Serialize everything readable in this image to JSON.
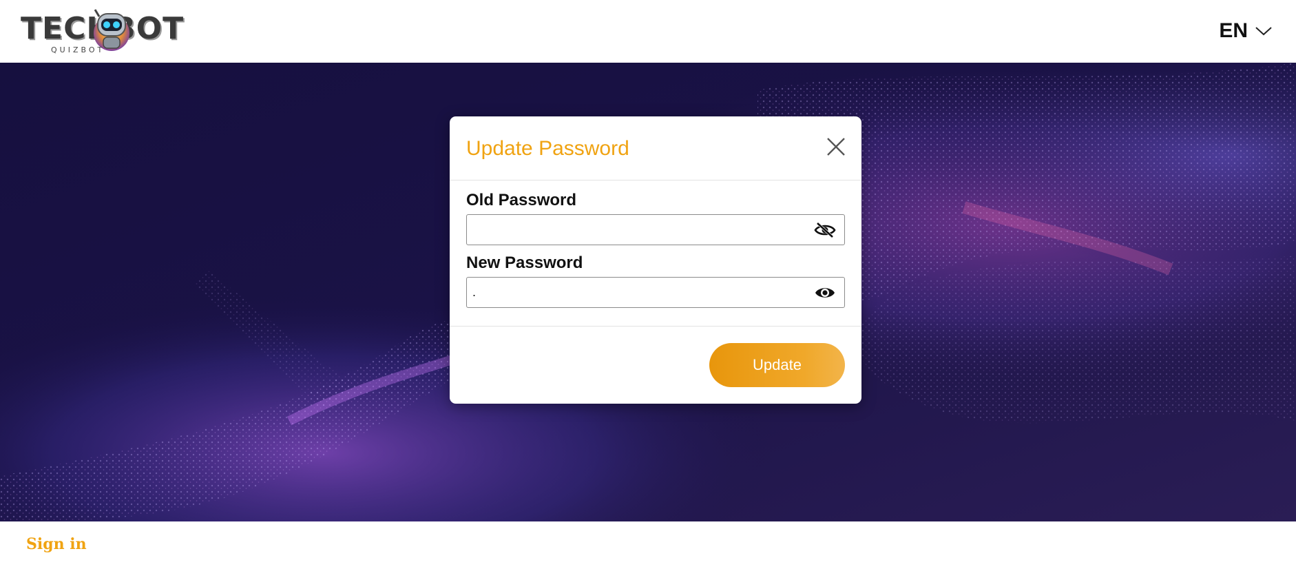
{
  "header": {
    "logo_text": "TECHBOT",
    "logo_subtext": "QUIZBOT",
    "language": {
      "selected": "EN",
      "icon": "chevron-down-icon"
    }
  },
  "modal": {
    "title": "Update Password",
    "close_icon": "close-icon",
    "fields": {
      "old_password": {
        "label": "Old Password",
        "value": "",
        "toggle_icon": "eye-slash-icon"
      },
      "new_password": {
        "label": "New Password",
        "value": ".",
        "toggle_icon": "eye-icon"
      }
    },
    "submit_label": "Update"
  },
  "footer": {
    "signin_label": "Sign in"
  },
  "colors": {
    "accent": "#f0a312",
    "button_gradient_start": "#e8960c",
    "button_gradient_end": "#f2b44a",
    "hero_background": "#140f3a"
  }
}
